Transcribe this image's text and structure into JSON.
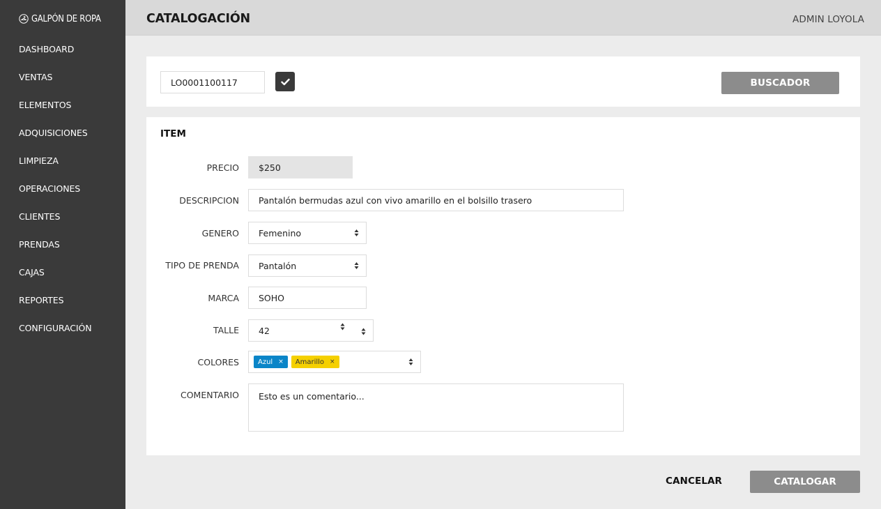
{
  "brand": {
    "icon": "hanger-circle-icon",
    "name": "GALPÓN DE ROPA"
  },
  "sidebar": {
    "items": [
      {
        "label": "DASHBOARD"
      },
      {
        "label": "VENTAS"
      },
      {
        "label": "ELEMENTOS"
      },
      {
        "label": "ADQUISICIONES"
      },
      {
        "label": "LIMPIEZA"
      },
      {
        "label": "OPERACIONES"
      },
      {
        "label": "CLIENTES"
      },
      {
        "label": "PRENDAS"
      },
      {
        "label": "CAJAS"
      },
      {
        "label": "REPORTES"
      },
      {
        "label": "CONFIGURACIÓN"
      }
    ]
  },
  "header": {
    "title": "CATALOGACIÓN",
    "user": "ADMIN LOYOLA"
  },
  "search": {
    "code_value": "LO0001100117",
    "confirm_icon": "checkmark-icon",
    "buscador_label": "BUSCADOR"
  },
  "item": {
    "title": "ITEM",
    "precio": {
      "label": "PRECIO",
      "value": "$250"
    },
    "descripcion": {
      "label": "DESCRIPCION",
      "value": "Pantalón bermudas azul con vivo amarillo en el bolsillo trasero"
    },
    "genero": {
      "label": "GENERO",
      "value": "Femenino"
    },
    "tipo_prenda": {
      "label": "TIPO DE PRENDA",
      "value": "Pantalón"
    },
    "marca": {
      "label": "MARCA",
      "value": "SOHO"
    },
    "talle": {
      "label": "TALLE",
      "value": "42"
    },
    "colores": {
      "label": "COLORES",
      "tags": [
        {
          "label": "Azul",
          "remove": "×",
          "color": "#0a85c8"
        },
        {
          "label": "Amarillo",
          "remove": "×",
          "color": "#f5d000"
        }
      ]
    },
    "comentario": {
      "label": "COMENTARIO",
      "value": "Esto es un comentario..."
    }
  },
  "actions": {
    "cancel_label": "CANCELAR",
    "submit_label": "CATALOGAR"
  },
  "colors": {
    "sidebar_bg": "#3a3a3a",
    "topbar_bg": "#d9d9d9",
    "button_gray": "#8c8c8c"
  }
}
